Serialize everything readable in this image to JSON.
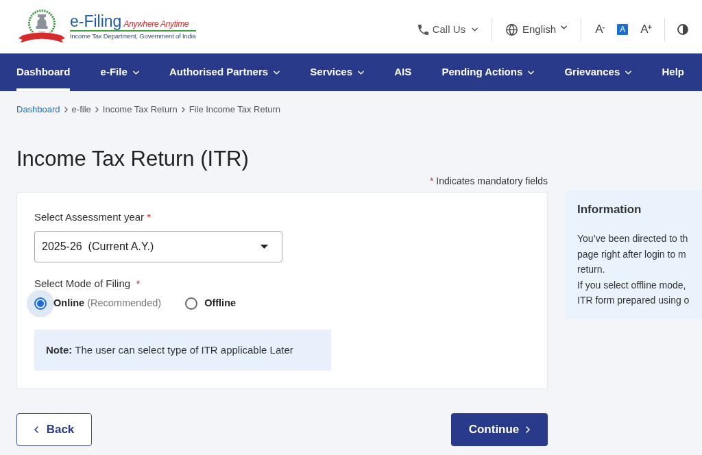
{
  "header": {
    "logo": {
      "title": "e-Filing",
      "tagline": "Anywhere Anytime",
      "subtitle": "Income Tax Department, Government of India"
    },
    "call_us": {
      "label": "Call Us"
    },
    "language": {
      "label": "English"
    },
    "text_size": [
      {
        "label": "A",
        "sign": "-",
        "selected": false
      },
      {
        "label": "A",
        "selected": true
      },
      {
        "label": "A",
        "sign": "+",
        "selected": false
      }
    ]
  },
  "nav": [
    {
      "label": "Dashboard",
      "selected": true,
      "dropdown": false
    },
    {
      "label": "e-File",
      "selected": false,
      "dropdown": true
    },
    {
      "label": "Authorised Partners",
      "selected": false,
      "dropdown": true
    },
    {
      "label": "Services",
      "selected": false,
      "dropdown": true
    },
    {
      "label": "AIS",
      "selected": false,
      "dropdown": false
    },
    {
      "label": "Pending Actions",
      "selected": false,
      "dropdown": true
    },
    {
      "label": "Grievances",
      "selected": false,
      "dropdown": true
    },
    {
      "label": "Help",
      "selected": false,
      "dropdown": false
    }
  ],
  "breadcrumb": [
    {
      "label": "Dashboard",
      "link": true
    },
    {
      "label": "e-file",
      "link": false
    },
    {
      "label": "Income Tax Return",
      "link": false
    },
    {
      "label": "File Income Tax Return",
      "link": false
    }
  ],
  "page_title": "Income Tax Return (ITR)",
  "mandatory_note": {
    "mark": "*",
    "text": "Indicates mandatory fields"
  },
  "form": {
    "assessment_year": {
      "label": "Select Assessment year",
      "required_mark": "*",
      "value": "2025-26  (Current A.Y.)"
    },
    "filing_mode": {
      "label": "Select Mode of Filing",
      "required_mark": "*",
      "options": [
        {
          "label": "Online",
          "hint": "(Recommended)",
          "selected": true
        },
        {
          "label": "Offline",
          "selected": false
        }
      ]
    },
    "note": "**Note:** The user can select type of ITR applicable Later"
  },
  "information": {
    "title": "Information",
    "lines": [
      "You’ve been directed to th",
      "page right after login to m",
      "return.",
      "If you select offline mode,",
      "ITR form prepared using o"
    ]
  },
  "buttons": [
    {
      "label": "Back",
      "kind": "secondary"
    },
    {
      "label": "Continue",
      "kind": "primary"
    }
  ]
}
